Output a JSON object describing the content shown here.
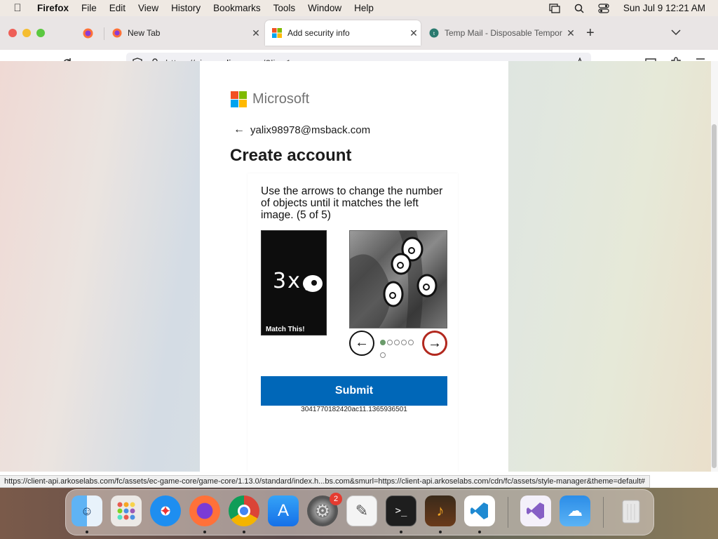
{
  "menubar": {
    "app": "Firefox",
    "items": [
      "File",
      "Edit",
      "View",
      "History",
      "Bookmarks",
      "Tools",
      "Window",
      "Help"
    ],
    "clock": "Sun Jul 9  12:21 AM"
  },
  "tabs": [
    {
      "label": "New Tab"
    },
    {
      "label": "Add security info"
    },
    {
      "label": "Temp Mail - Disposable Tempor"
    }
  ],
  "address": {
    "prefix": "https://signup.",
    "host": "live.com",
    "suffix": "/?lic=1"
  },
  "page": {
    "brand": "Microsoft",
    "identity": "yalix98978@msback.com",
    "title": "Create account",
    "puzzle": {
      "instruction": "Use the arrows to change the number of objects until it matches the left image. (5 of 5)",
      "target_count": "3x",
      "match_label": "Match This!",
      "current_page": 1,
      "total_pages": 6
    },
    "submit_label": "Submit",
    "session_id": "3041770182420ac11.1365936501"
  },
  "status_url": "https://client-api.arkoselabs.com/fc/assets/ec-game-core/game-core/1.13.0/standard/index.h...bs.com&smurl=https://client-api.arkoselabs.com/cdn/fc/assets/style-manager&theme=default#",
  "dock": {
    "badge_count": "2",
    "apps": [
      "finder-icon",
      "launchpad-icon",
      "safari-icon",
      "firefox-icon",
      "chrome-icon",
      "app-store-icon",
      "system-settings-icon",
      "textedit-icon",
      "terminal-icon",
      "garageband-icon",
      "vscode-icon",
      "visual-studio-icon",
      "weather-icon",
      "trash-icon"
    ]
  }
}
